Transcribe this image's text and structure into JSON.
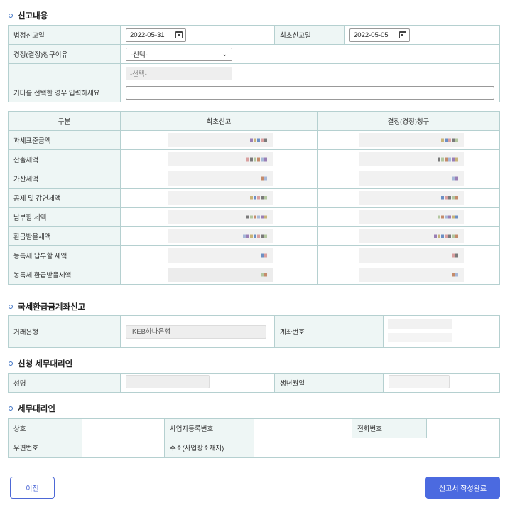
{
  "sections": {
    "report": "신고내용",
    "refund_account": "국세환급금계좌신고",
    "applicant_agent": "신청 세무대리인",
    "tax_agent": "세무대리인"
  },
  "report_info": {
    "legal_date_label": "법정신고일",
    "legal_date_value": "2022-05-31",
    "first_date_label": "최초신고일",
    "first_date_value": "2022-05-05",
    "reason_label": "경정(결정)청구이유",
    "reason_select": "-선택-",
    "reason_sub_select": "-선택-",
    "other_label": "기타를 선택한 경우 입력하세요",
    "other_value": ""
  },
  "amounts": {
    "headers": [
      "구분",
      "최초신고",
      "결정(경정)청구"
    ],
    "rows": [
      "과세표준금액",
      "산출세액",
      "가산세액",
      "공제 및 감면세액",
      "납부할 세액",
      "환급받을세액",
      "농특세 납부할 세액",
      "농특세 환급받을세액"
    ]
  },
  "refund_account": {
    "bank_label": "거래은행",
    "bank_value": "KEB하나은행",
    "account_label": "계좌번호"
  },
  "applicant_agent": {
    "name_label": "성명",
    "birth_label": "생년월일"
  },
  "tax_agent": {
    "company_label": "상호",
    "bizno_label": "사업자등록번호",
    "phone_label": "전화번호",
    "zip_label": "우편번호",
    "address_label": "주소(사업장소재지)"
  },
  "buttons": {
    "prev": "이전",
    "submit": "신고서 작성완료"
  },
  "colors": {
    "accent": "#4b6ae0",
    "label_bg": "#eef6f5",
    "border": "#b5d0d0"
  }
}
